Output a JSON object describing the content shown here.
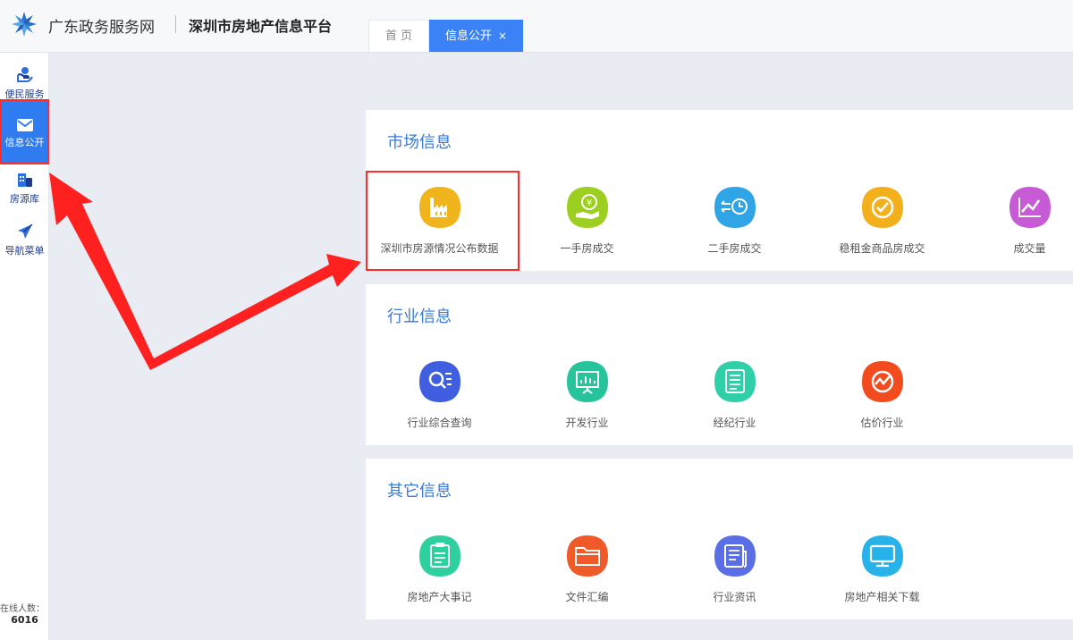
{
  "header": {
    "brand": "广东政务服务网",
    "platform": "深圳市房地产信息平台",
    "tabs": [
      {
        "label": "首 页"
      },
      {
        "label": "信息公开",
        "close": "×"
      }
    ]
  },
  "sidebar": {
    "items": [
      {
        "label": "便民服务"
      },
      {
        "label": "信息公开"
      },
      {
        "label": "房源库"
      },
      {
        "label": "导航菜单"
      }
    ],
    "online_label": "在线人数：",
    "online_count": "6016"
  },
  "sections": [
    {
      "title": "市场信息",
      "items": [
        {
          "label": "深圳市房源情况公布数据",
          "icon": "factory-icon",
          "color": "#f0b41d"
        },
        {
          "label": "一手房成交",
          "icon": "yen-hand-icon",
          "color": "#9ccf1f"
        },
        {
          "label": "二手房成交",
          "icon": "clock-transfer-icon",
          "color": "#2fa4e7"
        },
        {
          "label": "稳租金商品房成交",
          "icon": "check-circle-icon",
          "color": "#f2b01c"
        },
        {
          "label": "成交量",
          "icon": "trend-chart-icon",
          "color": "#c75bd6"
        }
      ]
    },
    {
      "title": "行业信息",
      "items": [
        {
          "label": "行业综合查询",
          "icon": "search-list-icon",
          "color": "#3f5fe0"
        },
        {
          "label": "开发行业",
          "icon": "presentation-icon",
          "color": "#27c49b"
        },
        {
          "label": "经纪行业",
          "icon": "document-list-icon",
          "color": "#2fd0a8"
        },
        {
          "label": "估价行业",
          "icon": "gauge-icon",
          "color": "#f24c1e"
        }
      ]
    },
    {
      "title": "其它信息",
      "items": [
        {
          "label": "房地产大事记",
          "icon": "clipboard-icon",
          "color": "#2fd0a0"
        },
        {
          "label": "文件汇编",
          "icon": "folder-icon",
          "color": "#f05a28"
        },
        {
          "label": "行业资讯",
          "icon": "news-icon",
          "color": "#5a6ee6"
        },
        {
          "label": "房地产相关下载",
          "icon": "monitor-icon",
          "color": "#28b2ea"
        }
      ]
    }
  ]
}
